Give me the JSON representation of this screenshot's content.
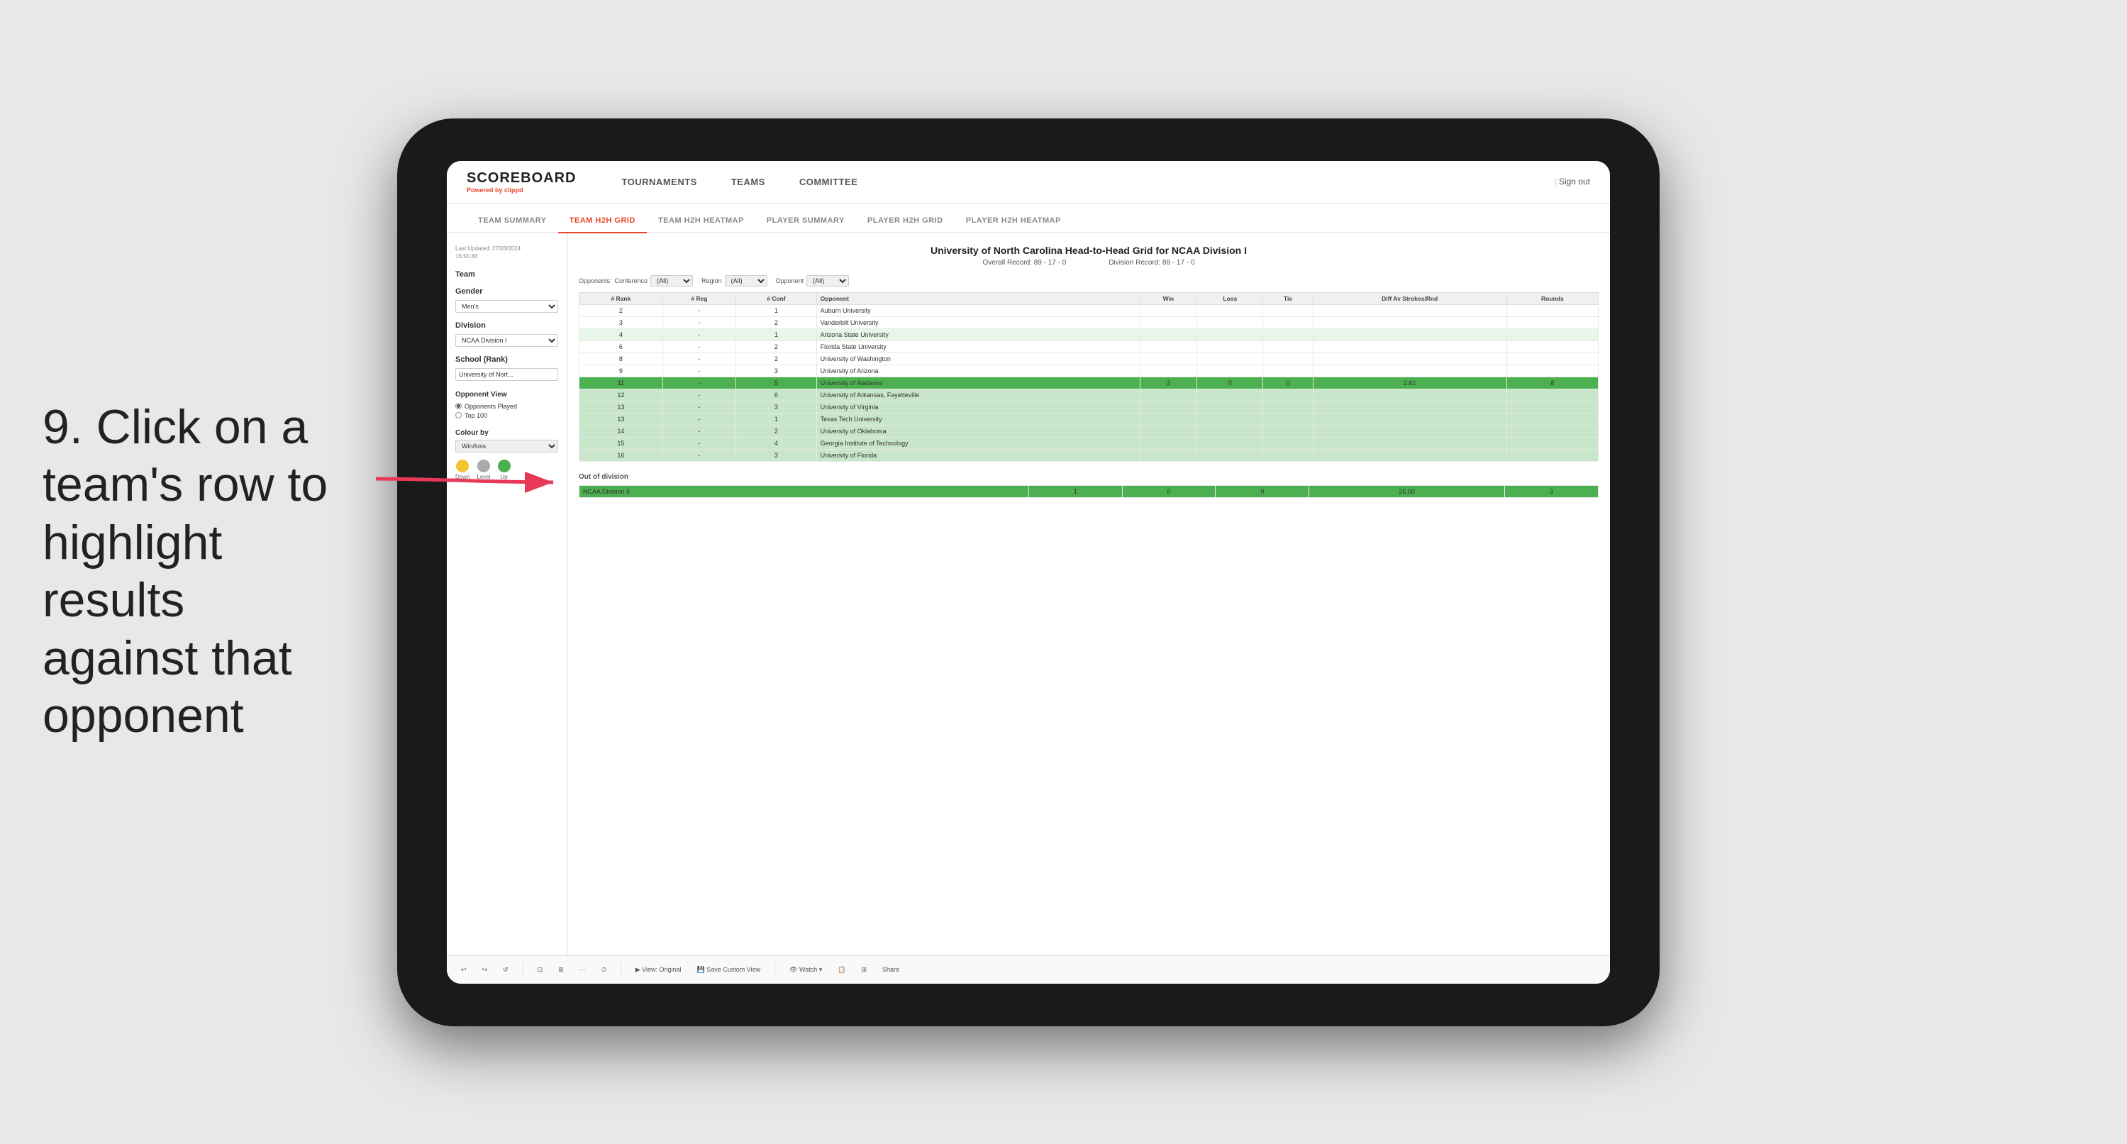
{
  "annotation": {
    "number": "9.",
    "text": "Click on a team's row to highlight results against that opponent"
  },
  "nav": {
    "logo": "SCOREBOARD",
    "logo_sub": "Powered by ",
    "logo_brand": "clippd",
    "items": [
      "TOURNAMENTS",
      "TEAMS",
      "COMMITTEE"
    ],
    "sign_out": "Sign out"
  },
  "sub_nav": {
    "tabs": [
      "TEAM SUMMARY",
      "TEAM H2H GRID",
      "TEAM H2H HEATMAP",
      "PLAYER SUMMARY",
      "PLAYER H2H GRID",
      "PLAYER H2H HEATMAP"
    ],
    "active": "TEAM H2H GRID"
  },
  "sidebar": {
    "last_updated_label": "Last Updated: 27/03/2024",
    "last_updated_time": "16:55:38",
    "team_label": "Team",
    "gender_label": "Gender",
    "gender_value": "Men's",
    "division_label": "Division",
    "division_value": "NCAA Division I",
    "school_label": "School (Rank)",
    "school_value": "University of Nort...",
    "opponent_view_label": "Opponent View",
    "opponents_played": "Opponents Played",
    "top_100": "Top 100",
    "colour_by_label": "Colour by",
    "colour_by_value": "Win/loss",
    "legend": {
      "down_label": "Down",
      "level_label": "Level",
      "up_label": "Up"
    }
  },
  "grid": {
    "title": "University of North Carolina Head-to-Head Grid for NCAA Division I",
    "overall_record_label": "Overall Record:",
    "overall_record": "89 - 17 - 0",
    "division_record_label": "Division Record:",
    "division_record": "88 - 17 - 0",
    "filters": {
      "opponents_label": "Opponents:",
      "conference_label": "Conference",
      "conference_value": "(All)",
      "region_label": "Region",
      "region_value": "(All)",
      "opponent_label": "Opponent",
      "opponent_value": "(All)"
    },
    "columns": [
      "# Rank",
      "# Reg",
      "# Conf",
      "Opponent",
      "Win",
      "Loss",
      "Tie",
      "Diff Av Strokes/Rnd",
      "Rounds"
    ],
    "rows": [
      {
        "rank": "2",
        "reg": "-",
        "conf": "1",
        "opponent": "Auburn University",
        "win": "",
        "loss": "",
        "tie": "",
        "diff": "",
        "rounds": "",
        "style": "normal"
      },
      {
        "rank": "3",
        "reg": "-",
        "conf": "2",
        "opponent": "Vanderbilt University",
        "win": "",
        "loss": "",
        "tie": "",
        "diff": "",
        "rounds": "",
        "style": "normal"
      },
      {
        "rank": "4",
        "reg": "-",
        "conf": "1",
        "opponent": "Arizona State University",
        "win": "",
        "loss": "",
        "tie": "",
        "diff": "",
        "rounds": "",
        "style": "light-green"
      },
      {
        "rank": "6",
        "reg": "-",
        "conf": "2",
        "opponent": "Florida State University",
        "win": "",
        "loss": "",
        "tie": "",
        "diff": "",
        "rounds": "",
        "style": "normal"
      },
      {
        "rank": "8",
        "reg": "-",
        "conf": "2",
        "opponent": "University of Washington",
        "win": "",
        "loss": "",
        "tie": "",
        "diff": "",
        "rounds": "",
        "style": "normal"
      },
      {
        "rank": "9",
        "reg": "-",
        "conf": "3",
        "opponent": "University of Arizona",
        "win": "",
        "loss": "",
        "tie": "",
        "diff": "",
        "rounds": "",
        "style": "normal"
      },
      {
        "rank": "11",
        "reg": "-",
        "conf": "5",
        "opponent": "University of Alabama",
        "win": "3",
        "loss": "0",
        "tie": "0",
        "diff": "2.61",
        "rounds": "8",
        "style": "selected"
      },
      {
        "rank": "12",
        "reg": "-",
        "conf": "6",
        "opponent": "University of Arkansas, Fayetteville",
        "win": "",
        "loss": "",
        "tie": "",
        "diff": "",
        "rounds": "",
        "style": "highlighted"
      },
      {
        "rank": "13",
        "reg": "-",
        "conf": "3",
        "opponent": "University of Virginia",
        "win": "",
        "loss": "",
        "tie": "",
        "diff": "",
        "rounds": "",
        "style": "highlighted"
      },
      {
        "rank": "13",
        "reg": "-",
        "conf": "1",
        "opponent": "Texas Tech University",
        "win": "",
        "loss": "",
        "tie": "",
        "diff": "",
        "rounds": "",
        "style": "highlighted"
      },
      {
        "rank": "14",
        "reg": "-",
        "conf": "2",
        "opponent": "University of Oklahoma",
        "win": "",
        "loss": "",
        "tie": "",
        "diff": "",
        "rounds": "",
        "style": "highlighted"
      },
      {
        "rank": "15",
        "reg": "-",
        "conf": "4",
        "opponent": "Georgia Institute of Technology",
        "win": "",
        "loss": "",
        "tie": "",
        "diff": "",
        "rounds": "",
        "style": "highlighted"
      },
      {
        "rank": "16",
        "reg": "-",
        "conf": "3",
        "opponent": "University of Florida",
        "win": "",
        "loss": "",
        "tie": "",
        "diff": "",
        "rounds": "",
        "style": "highlighted"
      }
    ],
    "out_of_division": {
      "title": "Out of division",
      "rows": [
        {
          "label": "NCAA Division II",
          "win": "1",
          "loss": "0",
          "tie": "0",
          "diff": "26.00",
          "rounds": "3",
          "style": "selected"
        }
      ]
    }
  },
  "toolbar": {
    "buttons": [
      "↩",
      "↪",
      "⤾",
      "⊡",
      "⊞",
      "·-·",
      "⏱",
      "View: Original",
      "Save Custom View",
      "👁 Watch ▾",
      "📋",
      "⊞",
      "Share"
    ]
  }
}
